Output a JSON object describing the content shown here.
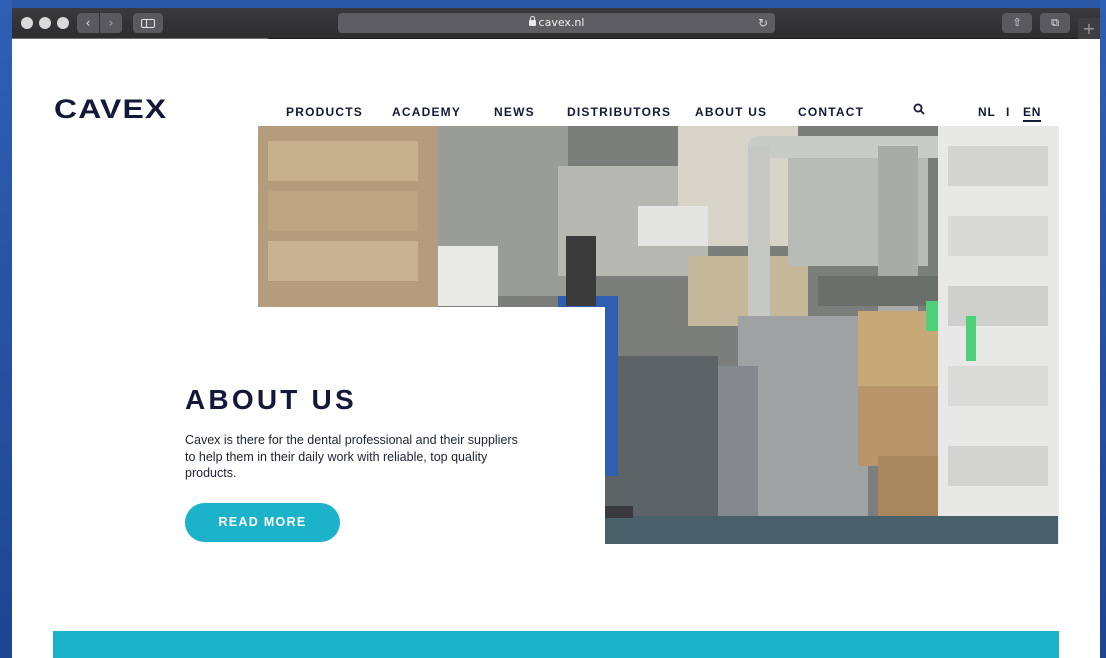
{
  "browser": {
    "url": "cavex.nl",
    "back_glyph": "‹",
    "forward_glyph": "›",
    "reload_glyph": "↻",
    "share_glyph": "⇧",
    "tabs_glyph": "⧉",
    "new_tab_glyph": "+"
  },
  "site": {
    "logo": "CAVEX",
    "nav": [
      "PRODUCTS",
      "ACADEMY",
      "NEWS",
      "DISTRIBUTORS",
      "ABOUT US",
      "CONTACT"
    ],
    "lang": {
      "nl": "NL",
      "separator": "I",
      "en": "EN",
      "active": "EN"
    }
  },
  "hero": {
    "heading": "ABOUT US",
    "text": "Cavex is there for the dental professional and their suppliers to help them in their daily work with reliable, top quality products.",
    "button": "READ MORE"
  },
  "colors": {
    "navy": "#14193a",
    "accent": "#1bb3c9",
    "desktop": "#2a57a8"
  },
  "icons": [
    "search-icon",
    "lock-icon",
    "reload-icon",
    "share-icon",
    "tabs-icon",
    "sidebar-icon"
  ]
}
